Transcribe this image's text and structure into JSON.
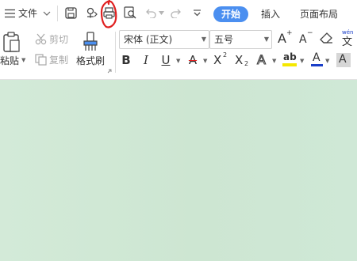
{
  "top_menu": {
    "file_label": "文件",
    "tabs": [
      "开始",
      "插入",
      "页面布局"
    ]
  },
  "clipboard": {
    "paste": "粘贴",
    "cut": "剪切",
    "copy": "复制",
    "format_painter": "格式刷"
  },
  "font": {
    "name": "宋体 (正文)",
    "size": "五号"
  },
  "colors": {
    "accent": "#4b8ff0",
    "canvas": "#cde6d2",
    "annotation": "#e02020",
    "highlight_bar": "#f5e800",
    "font_color_bar": "#1a3fc9"
  },
  "glyphs": {
    "superscript_2": "2",
    "subscript_2": "2",
    "bold": "B",
    "italic": "I",
    "underline": "U",
    "strike": "A",
    "grow": "A",
    "shrink": "A",
    "font_color": "A",
    "char_shade": "A",
    "pinyin": "wén"
  }
}
